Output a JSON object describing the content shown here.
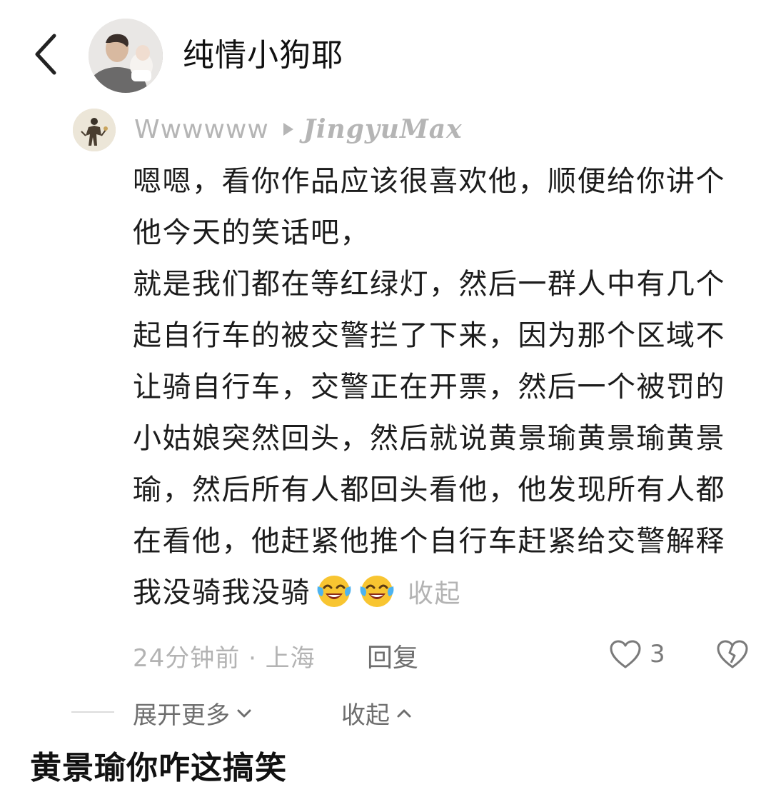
{
  "header": {
    "back_icon": "chevron-left-icon",
    "avatar_icon": "user-avatar",
    "username": "纯情小狗耶"
  },
  "comment": {
    "avatar_icon": "commenter-avatar",
    "author": "Wwwwww",
    "reply_arrow_icon": "play-triangle-icon",
    "reply_to": "JingyuMax",
    "paragraphs": [
      "嗯嗯，看你作品应该很喜欢他，顺便给你讲个他今天的笑话吧，",
      "就是我们都在等红绿灯，然后一群人中有几个起自行车的被交警拦了下来，因为那个区域不让骑自行车，交警正在开票，然后一个被罚的小姑娘突然回头，然后就说黄景瑜黄景瑜黄景瑜，然后所有人都回头看他，他发现所有人都在看他，他赶紧他推个自行车赶紧给交警解释我没骑我没骑"
    ],
    "emojis": [
      "crying-laughing-emoji",
      "crying-laughing-emoji"
    ],
    "collapse_inline": "收起",
    "timestamp": "24分钟前 · 上海",
    "reply_label": "回复",
    "like_count": "3",
    "like_icon": "heart-outline-icon",
    "dislike_icon": "broken-heart-icon"
  },
  "thread": {
    "expand_more": "展开更多",
    "collapse": "收起"
  },
  "caption": "黄景瑜你咋这搞笑",
  "colors": {
    "text_primary": "#1c1c1c",
    "text_muted": "#b3b3b3",
    "text_secondary": "#6e6e6e",
    "background": "#ffffff"
  }
}
